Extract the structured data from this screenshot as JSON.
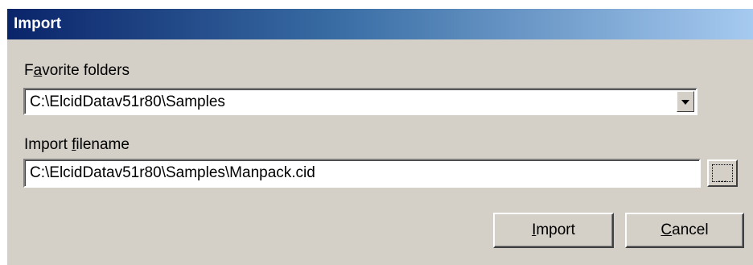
{
  "dialog": {
    "title": "Import",
    "favorite_folders": {
      "label_prefix": "F",
      "label_accel": "a",
      "label_rest": "vorite folders",
      "value": "C:\\ElcidDatav51r80\\Samples"
    },
    "import_filename": {
      "label_prefix": "Import ",
      "label_accel": "f",
      "label_rest": "ilename",
      "value": "C:\\ElcidDatav51r80\\Samples\\Manpack.cid",
      "browse_label": "..."
    },
    "buttons": {
      "import": {
        "accel": "I",
        "rest": "mport"
      },
      "cancel": {
        "accel": "C",
        "rest": "ancel"
      }
    }
  }
}
